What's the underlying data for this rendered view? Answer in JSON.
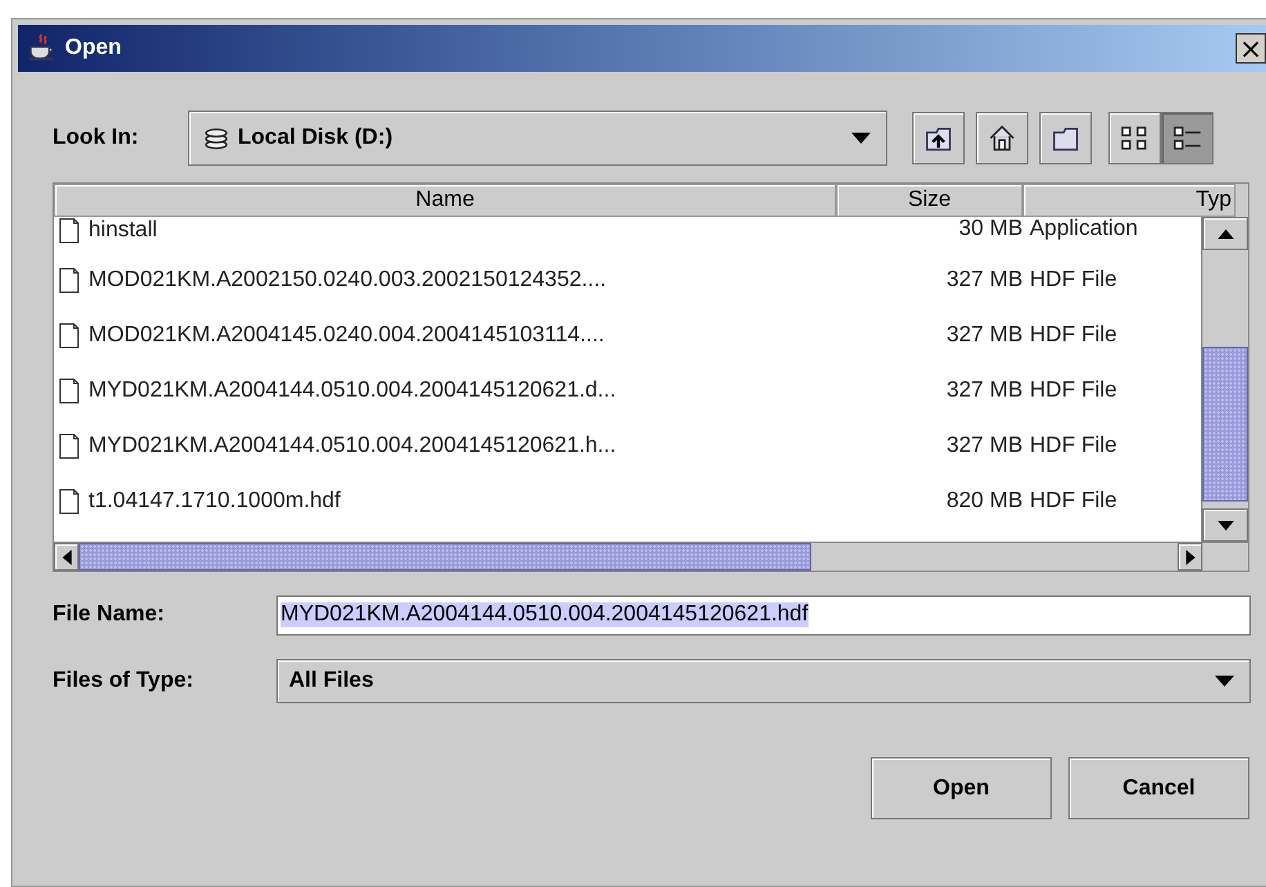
{
  "window": {
    "title": "Open",
    "close": "×"
  },
  "look_in": {
    "label": "Look In:",
    "value": "Local Disk (D:)"
  },
  "toolbar": [
    {
      "kind": "up",
      "selected": false
    },
    {
      "kind": "home",
      "selected": false
    },
    {
      "kind": "newfolder",
      "selected": false
    },
    {
      "kind": "list",
      "selected": false
    },
    {
      "kind": "details",
      "selected": true
    }
  ],
  "table": {
    "columns": [
      "Name",
      "Size",
      "Typ"
    ],
    "rows": [
      {
        "name": "hinstall",
        "size": "30 MB",
        "type": "Application"
      },
      {
        "name": "MOD021KM.A2002150.0240.003.2002150124352....",
        "size": "327 MB",
        "type": "HDF File"
      },
      {
        "name": "MOD021KM.A2004145.0240.004.2004145103114....",
        "size": "327 MB",
        "type": "HDF File"
      },
      {
        "name": "MYD021KM.A2004144.0510.004.2004145120621.d...",
        "size": "327 MB",
        "type": "HDF File"
      },
      {
        "name": "MYD021KM.A2004144.0510.004.2004145120621.h...",
        "size": "327 MB",
        "type": "HDF File"
      },
      {
        "name": "t1.04147.1710.1000m.hdf",
        "size": "820 MB",
        "type": "HDF File"
      }
    ]
  },
  "file_name": {
    "label": "File Name:",
    "value": "MYD021KM.A2004144.0510.004.2004145120621.hdf",
    "selected": true
  },
  "file_type": {
    "label": "Files of Type:",
    "value": "All Files"
  },
  "buttons": [
    "Open",
    "Cancel"
  ]
}
